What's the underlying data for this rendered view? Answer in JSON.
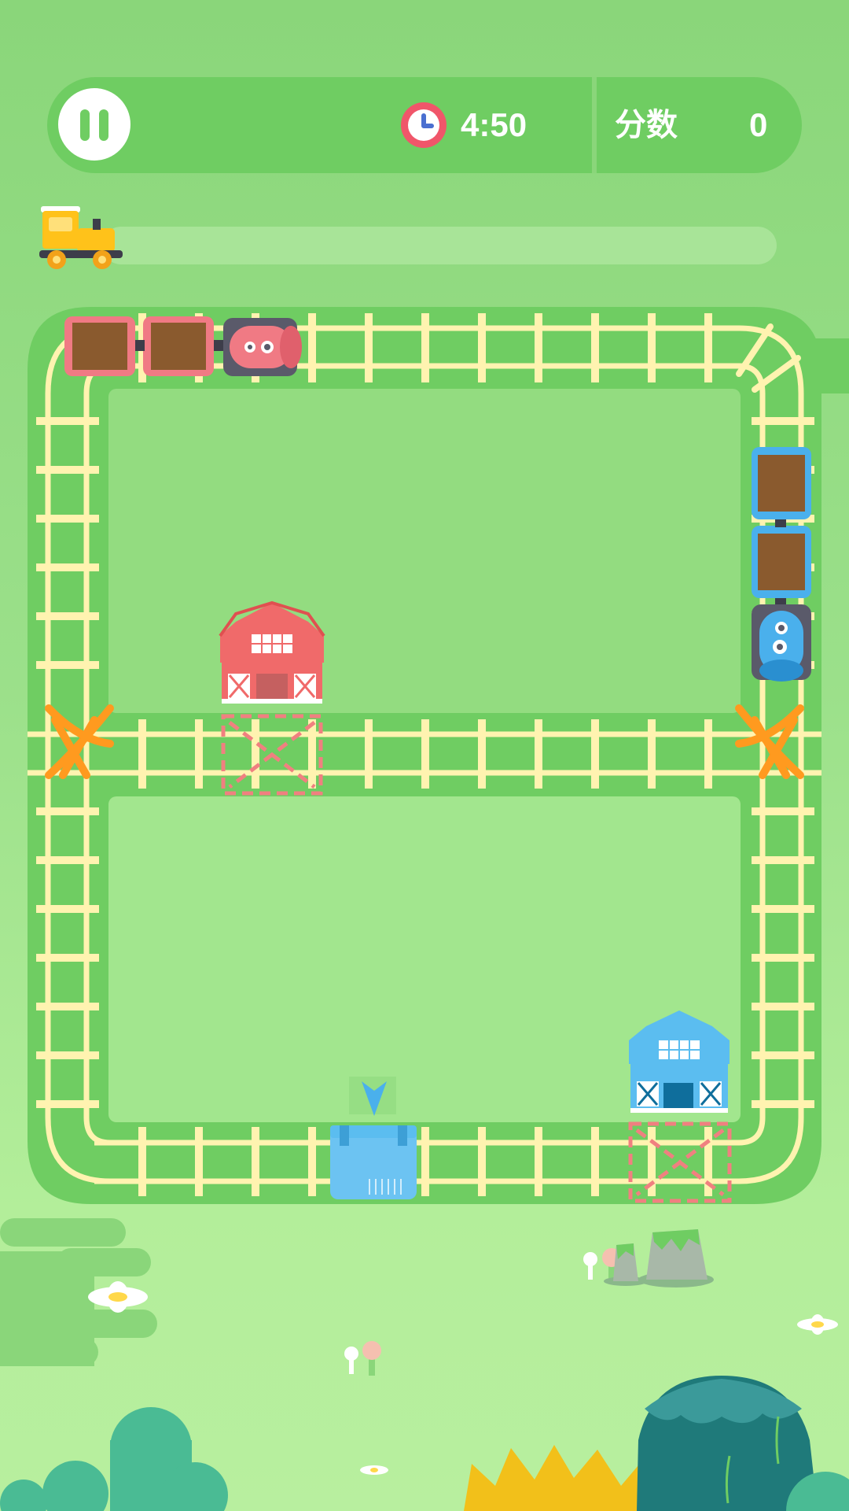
{
  "hud": {
    "pause_icon": "pause-icon",
    "clock_icon": "clock-icon",
    "timer": "4:50",
    "score_label": "分数",
    "score_value": "0"
  },
  "progress": {
    "level": 0.0,
    "train_icon": "yellow-train-icon"
  },
  "barns": {
    "red": {
      "color": "#f06a6a",
      "icon": "red-barn-icon"
    },
    "blue": {
      "color": "#5bbdf0",
      "icon": "blue-barn-icon"
    }
  },
  "trains": {
    "red": {
      "engine_color": "#f07a84",
      "cars": 2,
      "cargo": "brown-crate"
    },
    "blue": {
      "engine_color": "#4ab0ec",
      "cars": 2,
      "cargo": "brown-crate"
    }
  },
  "switches": [
    "left-switch",
    "right-switch",
    "top-right-switch"
  ],
  "colors": {
    "track_bed": "#6fcd62",
    "rail": "#fff3b0",
    "switch": "#ff9a1f",
    "station_marker": "#f08080"
  }
}
